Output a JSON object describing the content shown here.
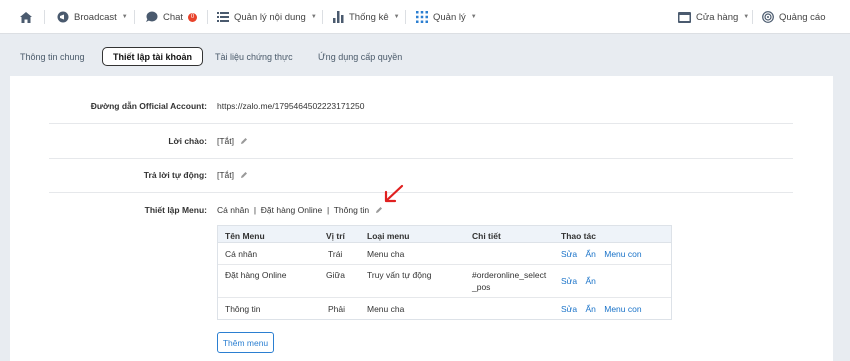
{
  "nav": {
    "broadcast": "Broadcast",
    "chat": "Chat",
    "chat_badge": "0",
    "content_mgmt": "Quản lý nội dung",
    "stats": "Thống kê",
    "manage": "Quản lý",
    "store": "Cửa hàng",
    "ads": "Quảng cáo"
  },
  "subtabs": {
    "general": "Thông tin chung",
    "account_settings": "Thiết lập tài khoản",
    "verification_docs": "Tài liệu chứng thực",
    "authorized_apps": "Ứng dụng cấp quyền"
  },
  "fields": {
    "oa_link_label": "Đường dẫn Official Account:",
    "oa_link_value": "https://zalo.me/1795464502223171250",
    "greeting_label": "Lời chào:",
    "greeting_value": "[Tắt]",
    "auto_reply_label": "Trả lời tự động:",
    "auto_reply_value": "[Tắt]",
    "menu_label": "Thiết lập Menu:",
    "menu_value": "Cá nhân  |  Đặt hàng Online  |  Thông tin"
  },
  "menu_table": {
    "headers": [
      "Tên Menu",
      "Vị trí",
      "Loại menu",
      "Chi tiết",
      "Thao tác"
    ],
    "rows": [
      {
        "name": "Cá nhân",
        "position": "Trái",
        "type": "Menu cha",
        "detail_1": "",
        "detail_2": "",
        "actions": [
          "Sửa",
          "Ẩn",
          "Menu con"
        ]
      },
      {
        "name": "Đặt hàng Online",
        "position": "Giữa",
        "type": "Truy vấn tự động",
        "detail_1": "#orderonline_select",
        "detail_2": "_pos",
        "actions": [
          "Sửa",
          "Ẩn"
        ]
      },
      {
        "name": "Thông tin",
        "position": "Phải",
        "type": "Menu cha",
        "detail_1": "",
        "detail_2": "",
        "actions": [
          "Sửa",
          "Ẩn",
          "Menu con"
        ]
      }
    ]
  },
  "add_menu_button": "Thêm menu",
  "colors": {
    "accent": "#1a73c9",
    "badge": "#e8432b",
    "annotation_arrow": "#e02020"
  }
}
